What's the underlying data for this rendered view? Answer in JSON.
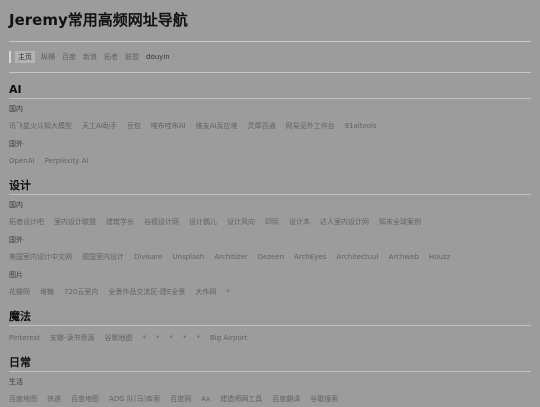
{
  "site": {
    "title": "Jeremy常用高频网址导航"
  },
  "nav": [
    {
      "label": "主页",
      "active": true
    },
    {
      "label": "纵横"
    },
    {
      "label": "百度"
    },
    {
      "label": "新浪"
    },
    {
      "label": "拓者"
    },
    {
      "label": "联盟"
    },
    {
      "label": "douyin"
    }
  ],
  "sections": [
    {
      "title": "AI",
      "groups": [
        {
          "title": "国内",
          "links": [
            "讯飞星火认知大模型",
            "天工AI助手",
            "豆包",
            "唯布哇布AI",
            "维友AI反应堆",
            "灵犀百通",
            "网易见外工作台",
            "91aitools"
          ]
        },
        {
          "title": "国外",
          "links": [
            "OpenAI",
            "Perplexity AI"
          ]
        }
      ]
    },
    {
      "title": "设计",
      "groups": [
        {
          "title": "国内",
          "links": [
            "拓者设计吧",
            "室内设计联盟",
            "建筑学长",
            "谷德设计网",
            "设计鹦儿",
            "设计风向",
            "印际",
            "设计本",
            "达人室内设计网",
            "知末全球案例"
          ]
        },
        {
          "title": "国外",
          "links": [
            "美国室内设计中文网",
            "德国室内设计",
            "Divisare",
            "Unsplash",
            "Architizer",
            "Dezeen",
            "ArchEyes",
            "Architectuul",
            "Archweb",
            "Houzz"
          ]
        },
        {
          "title": "图片",
          "links": [
            "花瓣网",
            "堆糖",
            "720云室内",
            "全景作品交流区-建E全景",
            "大作网",
            "*"
          ]
        }
      ]
    },
    {
      "title": "魔法",
      "groups": [
        {
          "title": "",
          "links": [
            "Pinterest",
            "安娜-读书资源",
            "谷歌地图",
            "*",
            "*",
            "*",
            "*",
            "*",
            "Big Airport"
          ]
        }
      ]
    },
    {
      "title": "日常",
      "groups": [
        {
          "title": "生活",
          "links": [
            "百度地图",
            "快递",
            "百度地图",
            "ADG 队(马)库索",
            "百度网",
            "Ax",
            "建造师网工具",
            "百度翻译",
            "谷歌搜索"
          ]
        }
      ]
    }
  ]
}
